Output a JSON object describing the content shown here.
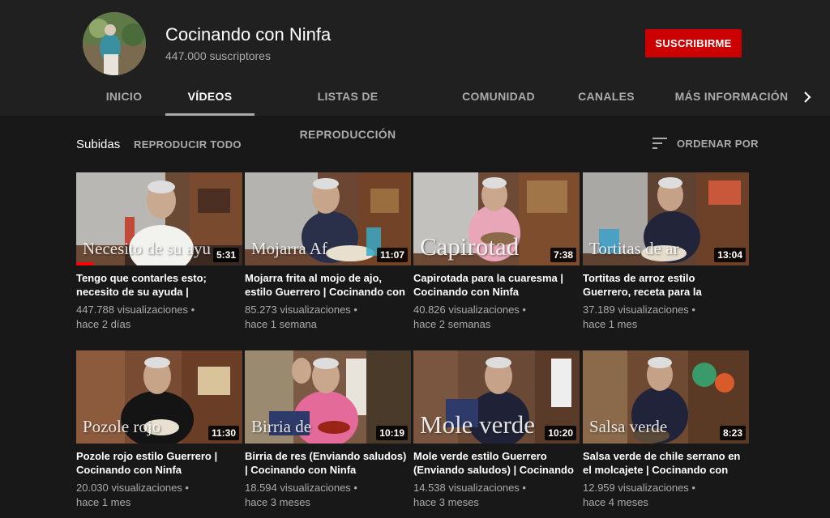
{
  "channel": {
    "name": "Cocinando con Ninfa",
    "subscribers": "447.000 suscriptores",
    "subscribe_label": "SUSCRIBIRME",
    "accent": "#cc0000"
  },
  "tabs": [
    {
      "label": "INICIO"
    },
    {
      "label": "VÍDEOS"
    },
    {
      "label": "LISTAS DE REPRODUCCIÓN"
    },
    {
      "label": "COMUNIDAD"
    },
    {
      "label": "CANALES"
    },
    {
      "label": "MÁS INFORMACIÓN"
    }
  ],
  "active_tab": "VÍDEOS",
  "uploads": {
    "label": "Subidas",
    "play_all": "REPRODUCIR TODO",
    "sort_label": "ORDENAR POR"
  },
  "videos": [
    {
      "overlay": "Necesito de su ayu",
      "duration": "5:31",
      "title": "Tengo que contarles esto; necesito de su ayuda | Cocinando con Ninfa",
      "views": "447.788 visualizaciones •",
      "age": "hace 2 días",
      "watched_fraction": 0.1
    },
    {
      "overlay": "Mojarra          Af",
      "duration": "11:07",
      "title": "Mojarra frita al mojo de ajo, estilo Guerrero | Cocinando con Ninfa",
      "views": "85.273 visualizaciones •",
      "age": "hace 1 semana"
    },
    {
      "overlay": "Capirotad",
      "duration": "7:38",
      "title": "Capirotada para la cuaresma | Cocinando con Ninfa",
      "views": "40.826 visualizaciones •",
      "age": "hace 2 semanas"
    },
    {
      "overlay": "Tortitas        de ar",
      "duration": "13:04",
      "title": "Tortitas de arroz estilo Guerrero, receta para la cuaresma",
      "views": "37.189 visualizaciones •",
      "age": "hace 1 mes"
    },
    {
      "overlay": "Pozole      rojo",
      "duration": "11:30",
      "title": "Pozole rojo estilo Guerrero | Cocinando con Ninfa",
      "views": "20.030 visualizaciones •",
      "age": "hace 1 mes"
    },
    {
      "overlay": "Birria           de",
      "duration": "10:19",
      "title": "Birria de res (Enviando saludos) | Cocinando con Ninfa",
      "views": "18.594 visualizaciones •",
      "age": "hace 3 meses"
    },
    {
      "overlay": "Mole verde",
      "duration": "10:20",
      "title": "Mole verde estilo Guerrero (Enviando saludos) | Cocinando con Ninfa",
      "views": "14.538 visualizaciones •",
      "age": "hace 3 meses"
    },
    {
      "overlay": "Salsa          verde",
      "duration": "8:23",
      "title": "Salsa verde de chile serrano en el molcajete | Cocinando con Ninfa",
      "views": "12.959 visualizaciones •",
      "age": "hace 4 meses"
    }
  ]
}
